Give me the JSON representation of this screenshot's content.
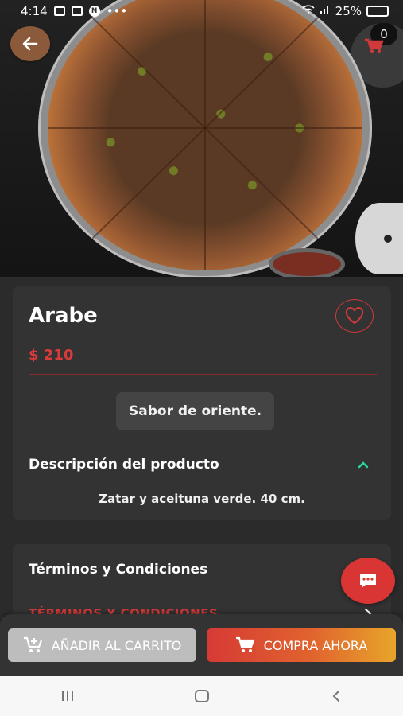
{
  "status_bar": {
    "time": "4:14",
    "battery": "25%",
    "notif_badge": "N"
  },
  "header": {
    "cart_count": "0"
  },
  "product": {
    "name": "Arabe",
    "price": "$ 210",
    "tagline": "Sabor de oriente.",
    "description_title": "Descripción del producto",
    "description": "Zatar y aceituna verde. 40 cm."
  },
  "terms": {
    "title": "Términos y Condiciones",
    "link": "TÉRMINOS Y CONDICIONES"
  },
  "actions": {
    "add_to_cart": "AÑADIR AL CARRITO",
    "buy_now": "COMPRA AHORA"
  },
  "colors": {
    "accent_red": "#d93b3b",
    "card_bg": "#333333",
    "page_bg": "#2b2b2b",
    "buy_gradient_end": "#e8a52a"
  },
  "icons": [
    "back-arrow-icon",
    "cart-icon",
    "heart-icon",
    "chevron-up-icon",
    "chevron-right-icon",
    "chat-icon",
    "add-cart-icon",
    "shopping-cart-icon"
  ]
}
